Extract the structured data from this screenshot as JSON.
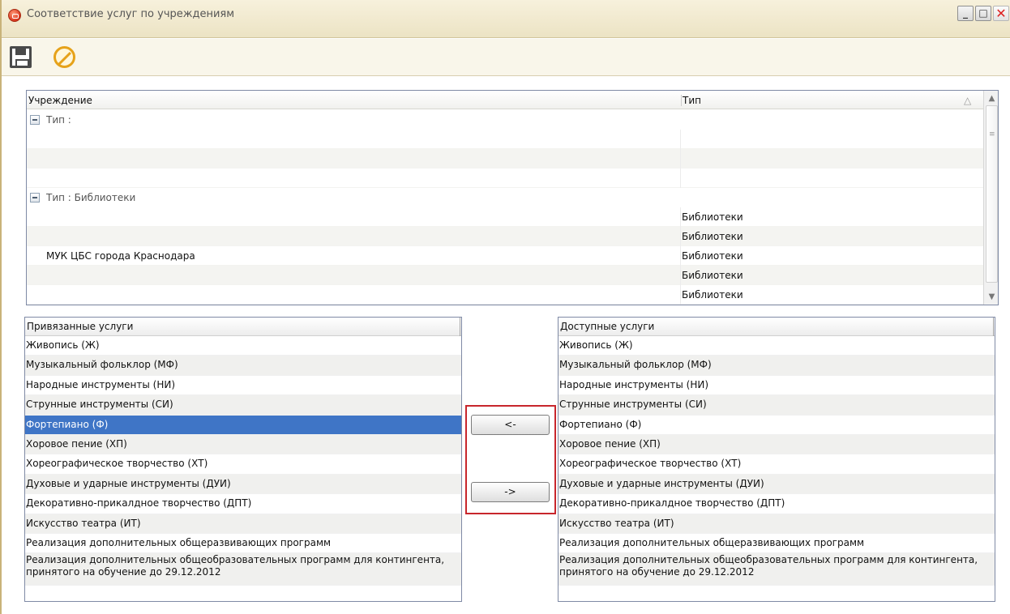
{
  "window": {
    "title": "Соответствие услуг по учреждениям",
    "min_label": "_",
    "max_label": "□",
    "close_label": "✕"
  },
  "toolbar": {
    "save_icon": "save-icon",
    "cancel_icon": "cancel-icon"
  },
  "grid": {
    "columns": [
      "Учреждение",
      "Тип"
    ],
    "sort_glyph": "△",
    "groups": [
      {
        "label": "Тип :",
        "rows": [
          {
            "institution": "",
            "type": ""
          },
          {
            "institution": "",
            "type": ""
          },
          {
            "institution": "",
            "type": ""
          }
        ]
      },
      {
        "label": "Тип : Библиотеки",
        "rows": [
          {
            "institution": "",
            "type": "Библиотеки"
          },
          {
            "institution": "",
            "type": "Библиотеки"
          },
          {
            "institution": "МУК ЦБС города Краснодара",
            "type": "Библиотеки"
          },
          {
            "institution": "",
            "type": "Библиотеки"
          },
          {
            "institution": "",
            "type": "Библиотеки"
          }
        ]
      }
    ]
  },
  "bound_services": {
    "header": "Привязанные услуги",
    "items": [
      "Живопись (Ж)",
      "Музыкальный фольклор (МФ)",
      "Народные инструменты (НИ)",
      "Струнные инструменты (СИ)",
      "Фортепиано (Ф)",
      "Хоровое пение (ХП)",
      "Хореографическое творчество (ХТ)",
      "Духовые и ударные инструменты (ДУИ)",
      "Декоративно-прикалдное творчество (ДПТ)",
      "Искусство театра (ИТ)",
      "Реализация дополнительных общеразвивающих программ",
      "Реализация дополнительных общеобразовательных программ для контингента, принятого на обучение до 29.12.2012"
    ],
    "selected_index": 4
  },
  "available_services": {
    "header": "Доступные услуги",
    "items": [
      "Живопись (Ж)",
      "Музыкальный фольклор (МФ)",
      "Народные инструменты (НИ)",
      "Струнные инструменты (СИ)",
      "Фортепиано (Ф)",
      "Хоровое пение (ХП)",
      "Хореографическое творчество (ХТ)",
      "Духовые и ударные инструменты (ДУИ)",
      "Декоративно-прикалдное творчество (ДПТ)",
      "Искусство театра (ИТ)",
      "Реализация дополнительных общеразвивающих программ",
      "Реализация дополнительных общеобразовательных программ для контингента, принятого на обучение до 29.12.2012"
    ]
  },
  "transfer": {
    "add_label": "<-",
    "remove_label": "->"
  },
  "colors": {
    "selection": "#3f75c6",
    "highlight_border": "#c8262c"
  }
}
